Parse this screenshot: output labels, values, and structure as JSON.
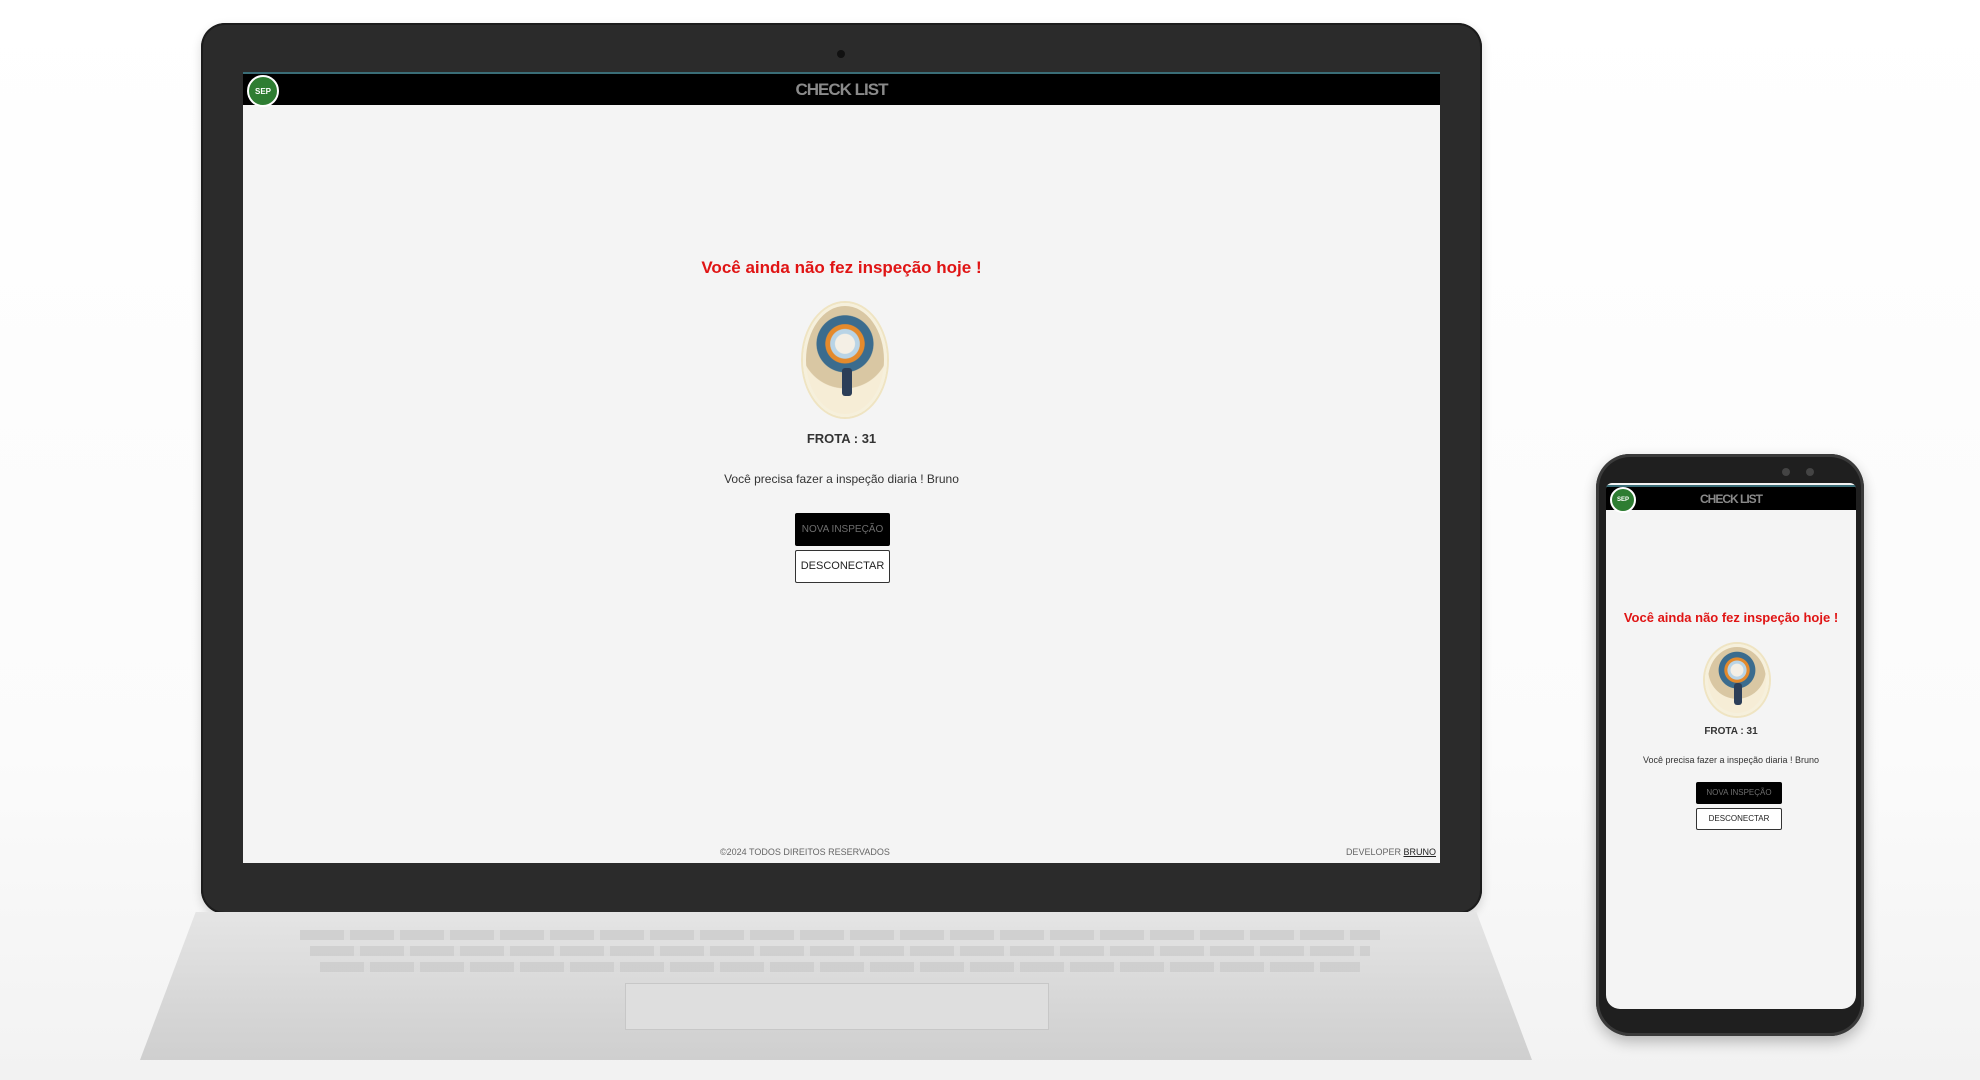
{
  "app": {
    "header_title": "CHECK LIST",
    "logo_text": "SEP",
    "heading": "Você ainda não fez inspeção hoje !",
    "frota": "FROTA : 31",
    "message": "Você precisa fazer a inspeção diaria ! Bruno",
    "primary_button": "NOVA INSPEÇÃO",
    "secondary_button": "DESCONECTAR",
    "footer_copyright": "©2024 TODOS DIREITOS RESERVADOS",
    "footer_dev_label": "DEVELOPER",
    "footer_dev_name": "BRUNO"
  },
  "colors": {
    "header_bg": "#000000",
    "heading": "#e01414",
    "page_bg": "#f4f4f4",
    "logo": "#2e7d32"
  },
  "icons": {
    "logo": "palmeiras-crest-icon",
    "avatar": "person-with-balloons-illustration"
  }
}
